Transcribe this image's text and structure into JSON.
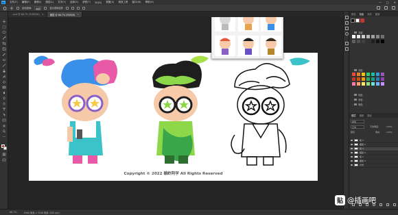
{
  "app": {
    "logo": "Ps"
  },
  "menu": [
    "文件(F)",
    "编辑(E)",
    "图像(I)",
    "图层(L)",
    "文字(Y)",
    "选择(S)",
    "滤镜(T)",
    "3D(D)",
    "视图(V)",
    "增效工具",
    "窗口(W)",
    "帮助(H)"
  ],
  "window_controls": {
    "minimize": "—",
    "maximize": "□",
    "close": "✕"
  },
  "options": {
    "auto_select": "自动选择:",
    "target": "图层",
    "show_transform": "显示变换控件"
  },
  "tabs": [
    {
      "label": "…psd @ 66.7% (RGB/8#)",
      "close": "×",
      "active": false
    },
    {
      "label": "图层 @ 66.7% (RGB/8)",
      "close": "×",
      "active": true
    }
  ],
  "canvas": {
    "copyright": "Copyright © 2022 躺岭阿学 All Rights Reserved"
  },
  "status": {
    "zoom": "66.7%",
    "info": "4960 像素 x 3508 像素 (300 ppi)"
  },
  "panels": {
    "top_tabs": [
      "颜色",
      "色板",
      "渐变",
      "图案"
    ],
    "swatch_groups": [
      "灰度",
      "浅色",
      "纯色",
      "深色",
      "暗色"
    ],
    "layers_tabs": [
      "图层",
      "通道",
      "路径"
    ],
    "layers_filter": "类型",
    "blend_mode": "正常",
    "opacity_label": "不透明度:",
    "opacity_value": "100%",
    "lock_label": "锁定:",
    "fill_label": "填充:",
    "fill_value": "100%",
    "layers": [
      "组 3",
      "图层 1",
      "组 2",
      "图层 2",
      "组 1",
      "图层 3",
      "背景"
    ]
  },
  "watermark": {
    "logo": "贴",
    "text": "@插画吧"
  },
  "colors": {
    "accent_blue": "#31a8ff",
    "hair_blue": "#3a8fe8",
    "hair_pink": "#e85aa8",
    "hair_green_dark": "#1e1e1e",
    "shirt_green": "#8dd84a",
    "leaf_green": "#3aa64a",
    "brush_teal": "#3bc3c9",
    "brush_lime": "#a8e04a"
  }
}
